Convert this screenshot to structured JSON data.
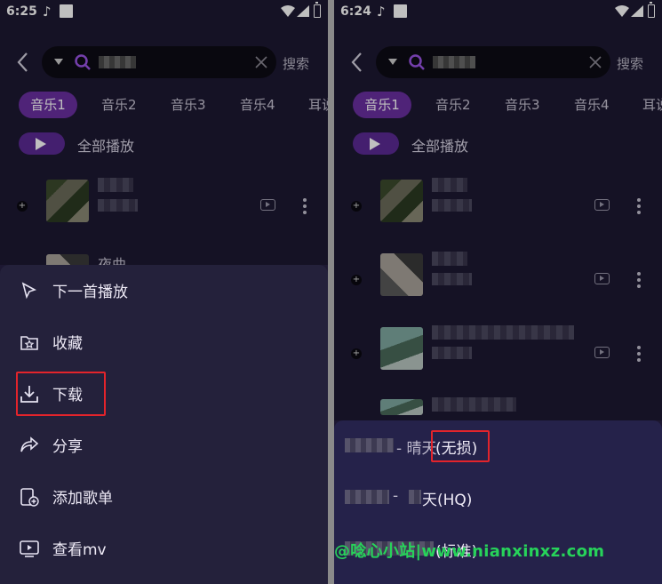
{
  "left": {
    "status": {
      "time": "6:25"
    },
    "search": {
      "button": "搜索"
    },
    "tabs": [
      "音乐1",
      "音乐2",
      "音乐3",
      "音乐4",
      "耳说"
    ],
    "play_all": "全部播放",
    "song2_title": "夜曲",
    "sheet": {
      "items": [
        {
          "label": "下一首播放",
          "icon": "next-play-icon"
        },
        {
          "label": "收藏",
          "icon": "favorite-folder-icon"
        },
        {
          "label": "下载",
          "icon": "download-icon"
        },
        {
          "label": "分享",
          "icon": "share-icon"
        },
        {
          "label": "添加歌单",
          "icon": "add-playlist-icon"
        },
        {
          "label": "查看mv",
          "icon": "mv-icon"
        }
      ]
    }
  },
  "right": {
    "status": {
      "time": "6:24"
    },
    "search": {
      "button": "搜索"
    },
    "tabs": [
      "音乐1",
      "音乐2",
      "音乐3",
      "音乐4",
      "耳说"
    ],
    "play_all": "全部播放",
    "quality": {
      "items": [
        {
          "prefix": "- 晴天",
          "label": "(无损)"
        },
        {
          "prefix": "- ",
          "label": "天(HQ)"
        },
        {
          "prefix": "",
          "label": "(标准)"
        }
      ]
    }
  },
  "watermark": "@唸心小站|www.nianxinxz.com",
  "colors": {
    "background": "#1d1832",
    "accent": "#6a2fa0",
    "highlight": "#e3242b",
    "watermark": "#27d35a"
  }
}
